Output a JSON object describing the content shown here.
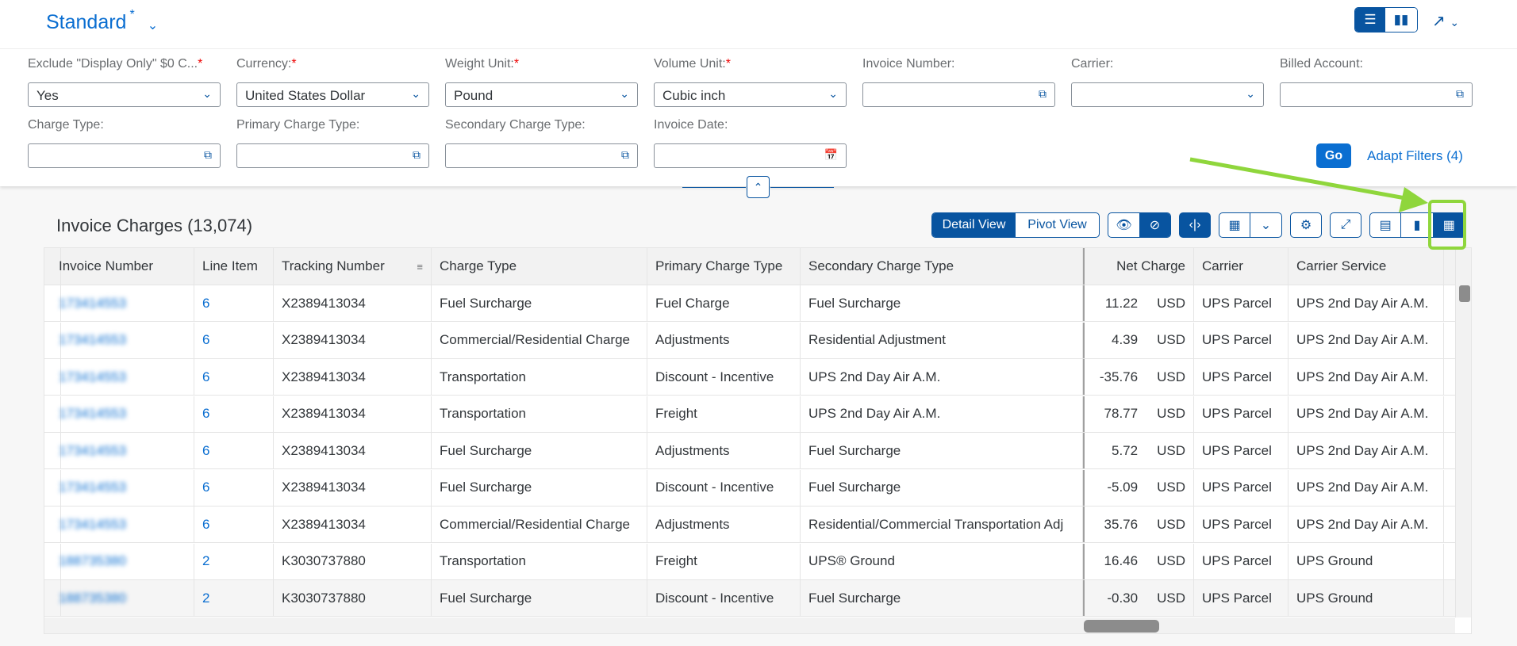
{
  "header": {
    "variant_title": "Standard",
    "modified_marker": "*"
  },
  "filters": [
    {
      "label": "Exclude \"Display Only\" $0 C...",
      "required": true,
      "value": "Yes",
      "type": "select"
    },
    {
      "label": "Currency:",
      "required": true,
      "value": "United States Dollar",
      "type": "select"
    },
    {
      "label": "Weight Unit:",
      "required": true,
      "value": "Pound",
      "type": "select"
    },
    {
      "label": "Volume Unit:",
      "required": true,
      "value": "Cubic inch",
      "type": "select"
    },
    {
      "label": "Invoice Number:",
      "required": false,
      "value": "",
      "type": "valuehelp"
    },
    {
      "label": "Carrier:",
      "required": false,
      "value": "",
      "type": "select"
    },
    {
      "label": "Billed Account:",
      "required": false,
      "value": "",
      "type": "valuehelp"
    },
    {
      "label": "Charge Type:",
      "required": false,
      "value": "",
      "type": "valuehelp"
    },
    {
      "label": "Primary Charge Type:",
      "required": false,
      "value": "",
      "type": "valuehelp"
    },
    {
      "label": "Secondary Charge Type:",
      "required": false,
      "value": "",
      "type": "valuehelp"
    },
    {
      "label": "Invoice Date:",
      "required": false,
      "value": "",
      "type": "date"
    }
  ],
  "filter_actions": {
    "go": "Go",
    "adapt": "Adapt Filters (4)"
  },
  "table": {
    "title": "Invoice Charges (13,074)",
    "views": {
      "detail": "Detail View",
      "pivot": "Pivot View"
    },
    "columns": [
      "Invoice Number",
      "Line Item",
      "Tracking Number",
      "Charge Type",
      "Primary Charge Type",
      "Secondary Charge Type",
      "Net Charge",
      "Carrier",
      "Carrier Service"
    ],
    "rows": [
      [
        "173414553",
        "6",
        "X2389413034",
        "Fuel Surcharge",
        "Fuel Charge",
        "Fuel Surcharge",
        "11.22",
        "USD",
        "UPS Parcel",
        "UPS 2nd Day Air A.M."
      ],
      [
        "173414553",
        "6",
        "X2389413034",
        "Commercial/Residential Charge",
        "Adjustments",
        "Residential Adjustment",
        "4.39",
        "USD",
        "UPS Parcel",
        "UPS 2nd Day Air A.M."
      ],
      [
        "173414553",
        "6",
        "X2389413034",
        "Transportation",
        "Discount - Incentive",
        "UPS 2nd Day Air A.M.",
        "-35.76",
        "USD",
        "UPS Parcel",
        "UPS 2nd Day Air A.M."
      ],
      [
        "173414553",
        "6",
        "X2389413034",
        "Transportation",
        "Freight",
        "UPS 2nd Day Air A.M.",
        "78.77",
        "USD",
        "UPS Parcel",
        "UPS 2nd Day Air A.M."
      ],
      [
        "173414553",
        "6",
        "X2389413034",
        "Fuel Surcharge",
        "Adjustments",
        "Fuel Surcharge",
        "5.72",
        "USD",
        "UPS Parcel",
        "UPS 2nd Day Air A.M."
      ],
      [
        "173414553",
        "6",
        "X2389413034",
        "Fuel Surcharge",
        "Discount - Incentive",
        "Fuel Surcharge",
        "-5.09",
        "USD",
        "UPS Parcel",
        "UPS 2nd Day Air A.M."
      ],
      [
        "173414553",
        "6",
        "X2389413034",
        "Commercial/Residential Charge",
        "Adjustments",
        "Residential/Commercial Transportation Adj",
        "35.76",
        "USD",
        "UPS Parcel",
        "UPS 2nd Day Air A.M."
      ],
      [
        "188735380",
        "2",
        "K3030737880",
        "Transportation",
        "Freight",
        "UPS® Ground",
        "16.46",
        "USD",
        "UPS Parcel",
        "UPS Ground"
      ],
      [
        "188735380",
        "2",
        "K3030737880",
        "Fuel Surcharge",
        "Discount - Incentive",
        "Fuel Surcharge",
        "-0.30",
        "USD",
        "UPS Parcel",
        "UPS Ground"
      ]
    ]
  },
  "colors": {
    "accent": "#0a6ed1",
    "highlight": "#8fd63c"
  }
}
